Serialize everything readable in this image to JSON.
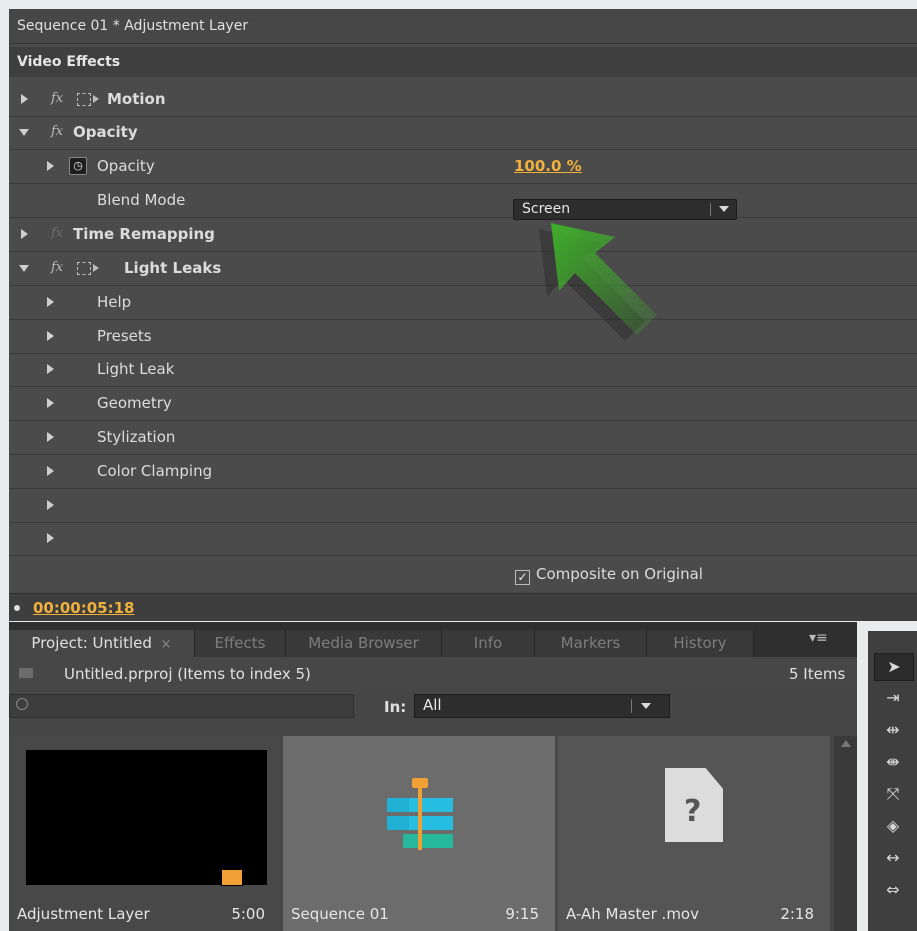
{
  "effect_controls": {
    "title": "Sequence 01 * Adjustment Layer",
    "header": "Video Effects",
    "rows": {
      "motion": "Motion",
      "opacity_group": "Opacity",
      "opacity_param": "Opacity",
      "opacity_value": "100.0 %",
      "blend_label": "Blend Mode",
      "blend_value": "Screen",
      "time_remap": "Time Remapping",
      "light_leaks": "Light Leaks",
      "help": "Help",
      "presets": "Presets",
      "light_leak": "Light Leak",
      "geometry": "Geometry",
      "stylization": "Stylization",
      "color_clamping": "Color Clamping"
    },
    "fx_symbol": "fx",
    "composite_label": "Composite on Original",
    "composite_checked": true,
    "timecode": "00:00:05:18",
    "accent_color": "#f0b03c",
    "arrow_color": "#3fae2a"
  },
  "project": {
    "tabs": [
      "Project: Untitled",
      "Effects",
      "Media Browser",
      "Info",
      "Markers",
      "History"
    ],
    "tab_close": "×",
    "path": "Untitled.prproj (Items to index 5)",
    "items_count": "5 Items",
    "in_label": "In:",
    "in_value": "All",
    "items": [
      {
        "name": "Adjustment Layer",
        "duration": "5:00"
      },
      {
        "name": "Sequence 01",
        "duration": "9:15"
      },
      {
        "name": "A-Ah Master .mov",
        "duration": "2:18"
      }
    ],
    "unknown_glyph": "?"
  },
  "tools": {
    "icons": [
      "selection-tool-icon",
      "track-select-tool-icon",
      "ripple-edit-tool-icon",
      "rolling-edit-tool-icon",
      "rate-stretch-tool-icon",
      "razor-tool-icon",
      "slip-tool-icon",
      "slide-tool-icon"
    ]
  }
}
